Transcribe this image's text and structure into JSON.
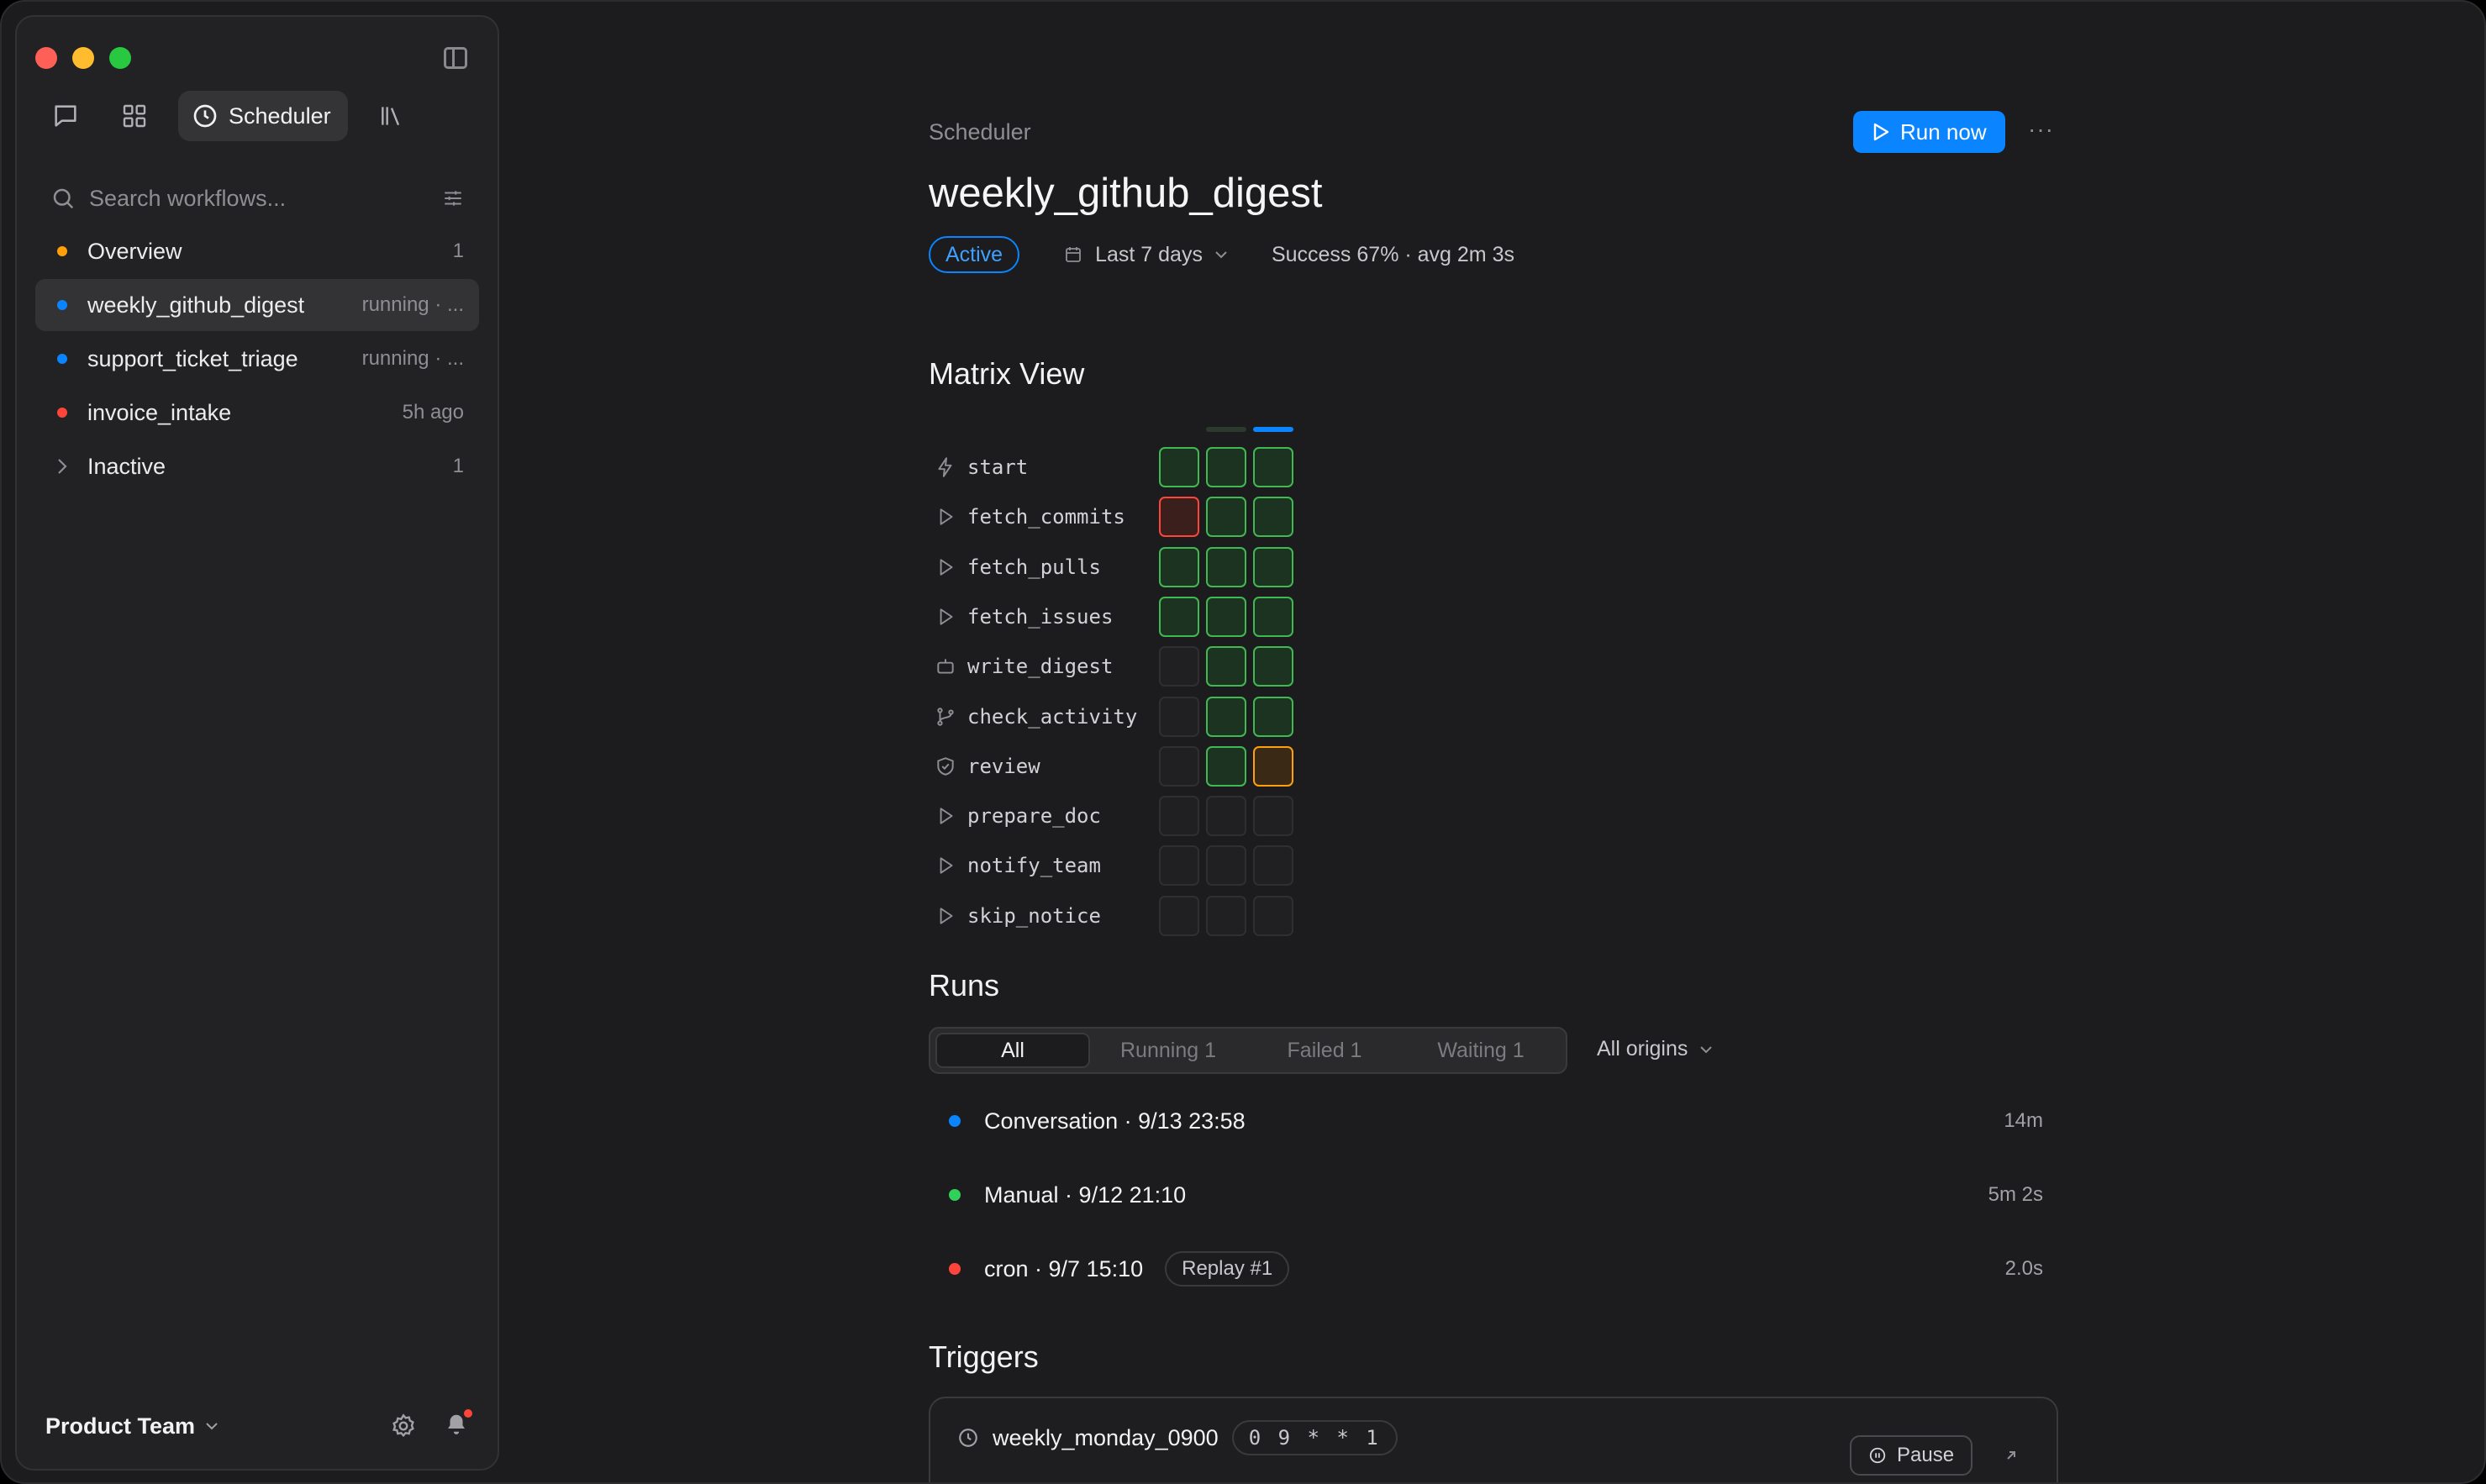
{
  "sidebar": {
    "tabs": [
      {
        "icon": "chat-bubble-icon"
      },
      {
        "icon": "grid-icon"
      },
      {
        "icon": "clock-icon",
        "label": "Scheduler"
      },
      {
        "icon": "library-icon"
      }
    ],
    "search_placeholder": "Search workflows...",
    "items": [
      {
        "name": "Overview",
        "meta": "1",
        "dot_color": "#ff9f0a"
      },
      {
        "name": "weekly_github_digest",
        "meta": "running · ...",
        "dot_color": "#0a84ff",
        "selected": true
      },
      {
        "name": "support_ticket_triage",
        "meta": "running · ...",
        "dot_color": "#0a84ff"
      },
      {
        "name": "invoice_intake",
        "meta": "5h ago",
        "dot_color": "#ff453a"
      },
      {
        "name": "Inactive",
        "meta": "1"
      }
    ],
    "team": "Product Team"
  },
  "main": {
    "breadcrumb": "Scheduler",
    "run_now": "Run now",
    "more": "···",
    "title": "weekly_github_digest",
    "status_badge": "Active",
    "range": "Last 7 days",
    "stats": "Success 67% · avg 2m 3s",
    "matrix_title": "Matrix View",
    "matrix": [
      {
        "label": "start",
        "icon": "bolt-icon",
        "cells": [
          "ok",
          "ok",
          "ok"
        ]
      },
      {
        "label": "fetch_commits",
        "icon": "play-icon",
        "cells": [
          "fail",
          "ok",
          "ok"
        ]
      },
      {
        "label": "fetch_pulls",
        "icon": "play-icon",
        "cells": [
          "ok",
          "ok",
          "ok"
        ]
      },
      {
        "label": "fetch_issues",
        "icon": "play-icon",
        "cells": [
          "ok",
          "ok",
          "ok"
        ]
      },
      {
        "label": "write_digest",
        "icon": "robot-icon",
        "cells": [
          "empty",
          "ok",
          "ok"
        ]
      },
      {
        "label": "check_activity",
        "icon": "branch-icon",
        "cells": [
          "empty",
          "ok",
          "ok"
        ]
      },
      {
        "label": "review",
        "icon": "shield-check-icon",
        "cells": [
          "empty",
          "ok",
          "warn"
        ]
      },
      {
        "label": "prepare_doc",
        "icon": "play-icon",
        "cells": [
          "empty",
          "empty",
          "empty"
        ]
      },
      {
        "label": "notify_team",
        "icon": "play-icon",
        "cells": [
          "empty",
          "empty",
          "empty"
        ]
      },
      {
        "label": "skip_notice",
        "icon": "play-icon",
        "cells": [
          "empty",
          "empty",
          "empty"
        ]
      }
    ],
    "runs_title": "Runs",
    "run_filters": [
      "All",
      "Running 1",
      "Failed 1",
      "Waiting 1"
    ],
    "origins": "All origins",
    "runs": [
      {
        "label": "Conversation · 9/13 23:58",
        "duration": "14m",
        "dot_color": "#0a84ff"
      },
      {
        "label": "Manual · 9/12 21:10",
        "duration": "5m 2s",
        "dot_color": "#30d158"
      },
      {
        "label": "cron · 9/7 15:10",
        "duration": "2.0s",
        "dot_color": "#ff453a",
        "badge": "Replay #1"
      }
    ],
    "triggers_title": "Triggers",
    "trigger": {
      "name": "weekly_monday_0900",
      "cron": "0 9 * * 1",
      "pause": "Pause"
    }
  },
  "colors": {
    "accent": "#0a84ff",
    "ok": "#3fb950",
    "fail": "#ff453a",
    "warn": "#ff9f0a"
  }
}
